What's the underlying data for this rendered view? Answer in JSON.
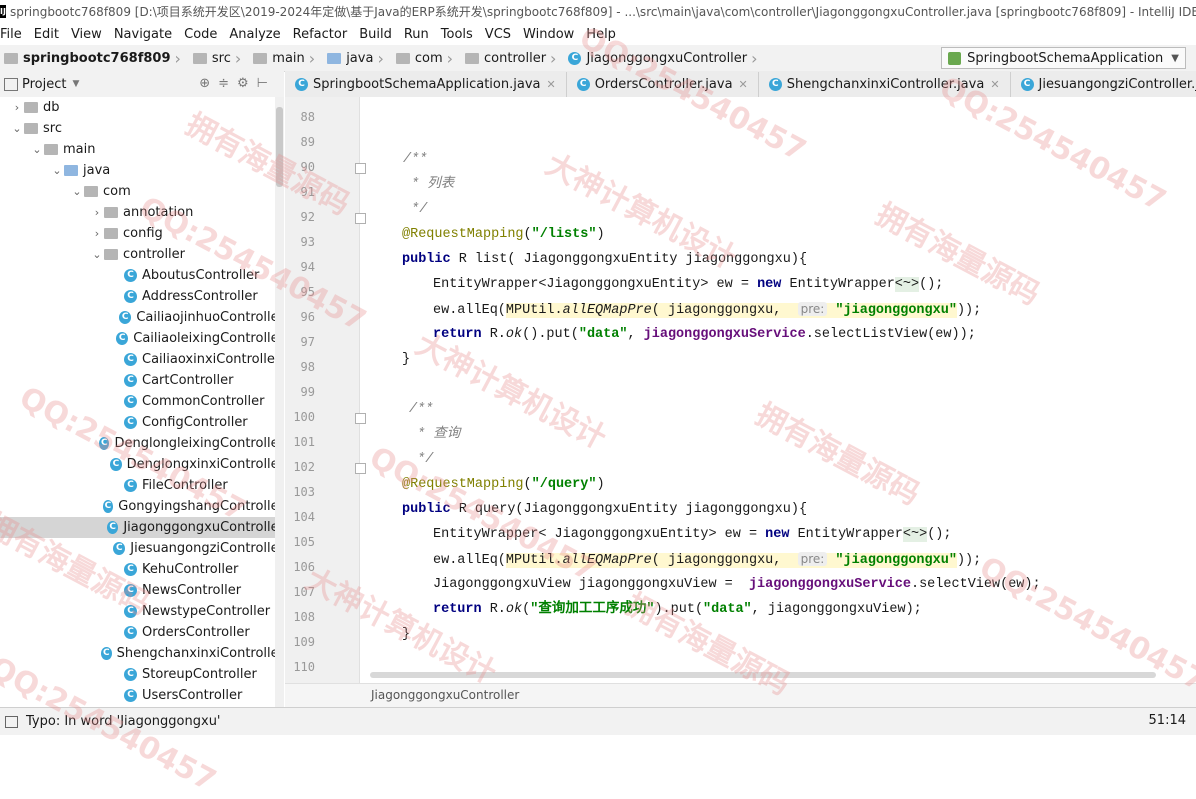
{
  "window": {
    "title": "springbootc768f809 [D:\\项目系统开发区\\2019-2024年定做\\基于Java的ERP系统开发\\springbootc768f809] - ...\\src\\main\\java\\com\\controller\\JiagonggongxuController.java [springbootc768f809] - IntelliJ IDEA"
  },
  "menu": [
    "File",
    "Edit",
    "View",
    "Navigate",
    "Code",
    "Analyze",
    "Refactor",
    "Build",
    "Run",
    "Tools",
    "VCS",
    "Window",
    "Help"
  ],
  "breadcrumb": [
    "springbootc768f809",
    "src",
    "main",
    "java",
    "com",
    "controller",
    "JiagonggongxuController"
  ],
  "run_config": "SpringbootSchemaApplication",
  "project_panel": {
    "title": "Project",
    "tree": [
      {
        "label": "db",
        "expanded": false,
        "type": "folder"
      },
      {
        "label": "src",
        "expanded": true,
        "type": "folder"
      },
      {
        "label": "main",
        "expanded": true,
        "type": "folder"
      },
      {
        "label": "java",
        "expanded": true,
        "type": "folder-blue"
      },
      {
        "label": "com",
        "expanded": true,
        "type": "folder"
      },
      {
        "label": "annotation",
        "expanded": false,
        "type": "folder"
      },
      {
        "label": "config",
        "expanded": false,
        "type": "folder"
      },
      {
        "label": "controller",
        "expanded": true,
        "type": "folder"
      },
      {
        "label": "AboutusController",
        "type": "class"
      },
      {
        "label": "AddressController",
        "type": "class"
      },
      {
        "label": "CailiaojinhuoController",
        "type": "class"
      },
      {
        "label": "CailiaoleixingController",
        "type": "class"
      },
      {
        "label": "CailiaoxinxiController",
        "type": "class"
      },
      {
        "label": "CartController",
        "type": "class"
      },
      {
        "label": "CommonController",
        "type": "class"
      },
      {
        "label": "ConfigController",
        "type": "class"
      },
      {
        "label": "DenglongleixingController",
        "type": "class"
      },
      {
        "label": "DenglongxinxiController",
        "type": "class"
      },
      {
        "label": "FileController",
        "type": "class"
      },
      {
        "label": "GongyingshangController",
        "type": "class"
      },
      {
        "label": "JiagonggongxuController",
        "type": "class",
        "selected": true
      },
      {
        "label": "JiesuangongziController",
        "type": "class"
      },
      {
        "label": "KehuController",
        "type": "class"
      },
      {
        "label": "NewsController",
        "type": "class"
      },
      {
        "label": "NewstypeController",
        "type": "class"
      },
      {
        "label": "OrdersController",
        "type": "class"
      },
      {
        "label": "ShengchanxinxiController",
        "type": "class"
      },
      {
        "label": "StoreupController",
        "type": "class"
      },
      {
        "label": "UsersController",
        "type": "class"
      }
    ]
  },
  "tabs": [
    {
      "label": "SpringbootSchemaApplication.java"
    },
    {
      "label": "OrdersController.java"
    },
    {
      "label": "ShengchanxinxiController.java"
    },
    {
      "label": "JiesuangongziController.java"
    }
  ],
  "editor": {
    "line_numbers": [
      "88",
      "89",
      "90",
      "91",
      "92",
      "93",
      "94",
      "95",
      "96",
      "97",
      "98",
      "99",
      "100",
      "101",
      "102",
      "103",
      "104",
      "105",
      "106",
      "107",
      "108",
      "109",
      "110"
    ],
    "strings": {
      "comment_open": "/**",
      "comment_list": " * 列表",
      "comment_close": " */",
      "comment_query": " * 查询",
      "ann_mapping": "@RequestMapping",
      "path_lists": "\"/lists\"",
      "path_query": "\"/query\"",
      "kw_public": "public",
      "kw_new": "new",
      "kw_return": "return",
      "hint_pre": "pre:",
      "str_prefix": "\"jiagonggongxu\"",
      "str_data": "\"data\"",
      "str_msg": "\"查询加工工序成功\"",
      "svc": "jiagonggongxuService",
      "mth_allEQMapPre": "allEQMapPre",
      "mth_ok": "ok"
    },
    "footer_breadcrumb": "JiagonggongxuController"
  },
  "status": {
    "message": "Typo: In word 'Jiagonggongxu'",
    "position": "51:14"
  },
  "watermarks": [
    "大神计算机设计",
    "拥有海量源码",
    "QQ:254540457"
  ]
}
